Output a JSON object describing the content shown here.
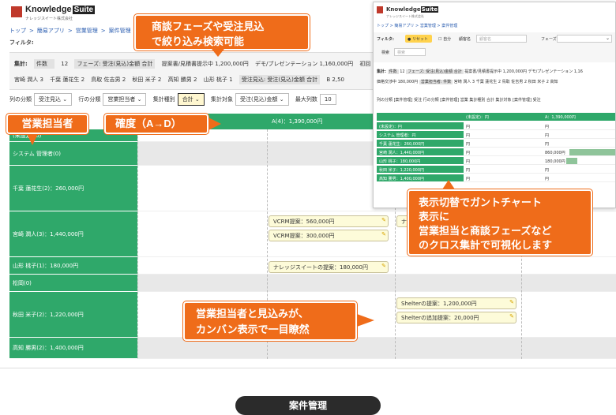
{
  "app": {
    "name": "Knowledge",
    "name_box": "Suite",
    "subtitle": "ナレッジスイート株式会社"
  },
  "breadcrumb": [
    "トップ",
    ">",
    "簡易アプリ",
    ">",
    "営業管理",
    ">",
    "案件管理"
  ],
  "filter_label": "フィルタ:",
  "summary": {
    "label": "集計:",
    "count_label": "件数",
    "count_value": "12",
    "phase_chip": "フェーズ: 受注(見込)金額 合計",
    "line1_items": [
      "提案書/見積書提示中 1,200,000円",
      "デモ/プレゼンテーション 1,160,000円",
      "初回"
    ],
    "line2_items": [
      "宮崎 潤人 3",
      "千葉 蓮花生 2",
      "鳥取 佐吉男 2",
      "秋田 米子 2",
      "高知 勝男 2",
      "山形 桃子 1"
    ],
    "line2_chip": "受注見込: 受注(見込)金額 合計",
    "line2_tail": "B 2,50"
  },
  "controls": {
    "col_label": "列の分類",
    "col_value": "受注見込",
    "row_label": "行の分類",
    "row_value": "営業担当者",
    "agg_label": "集計種別",
    "agg_value": "合計",
    "target_label": "集計対象",
    "target_value": "受注(見込)金額",
    "max_label": "最大列数",
    "max_value": "10"
  },
  "board": {
    "col_a_header": "A(4)：1,390,000円",
    "rows": [
      {
        "name": "(未設定)(0)"
      },
      {
        "name": "システム 管理者(0)"
      },
      {
        "name": "千葉 蓮花生(2)：260,000円"
      },
      {
        "name": "宮崎 潤人(3)：1,440,000円"
      },
      {
        "name": "山形 桃子(1)：180,000円"
      },
      {
        "name": "松岡(0)"
      },
      {
        "name": "秋田 米子(2)：1,220,000円"
      },
      {
        "name": "高知 勝男(2)：1,400,000円"
      }
    ],
    "cards": {
      "vcrm1": "VCRM提案：560,000円",
      "vcrm2": "VCRM提案：300,000円",
      "knowledge_cut": "ナレ",
      "knowledge_suite": "ナレッジスイートの提案：180,000円",
      "shelter1": "Shelterの提案：1,200,000円",
      "shelter2": "Shelterの追加提案：20,000円"
    }
  },
  "callouts": {
    "top": [
      "商談フェーズや受注見込",
      "で絞り込み検索可能"
    ],
    "rep": "営業担当者",
    "grade": "確度（A→D）",
    "gantt": [
      "表示切替でガントチャート",
      "表示に",
      "営業担当と商談フェーズなど",
      "のクロス集計で可視化します"
    ],
    "kanban": [
      "営業担当者と見込みが、",
      "カンバン表示で一目瞭然"
    ]
  },
  "inset": {
    "filter_label": "フィルタ:",
    "reset_btn": "リセット",
    "mine_label": "自分",
    "company_label": "顧客名",
    "company_placeholder": "顧客名",
    "phase_label": "フェーズ",
    "search_label": "検索",
    "search_placeholder": "検索",
    "sum_label": "集計:",
    "count_label": "件数",
    "count_value": "12",
    "sum_chip": "フェーズ: 受注(見込)金額 合計",
    "sum_line1_tail": "提案書/見積書提示中 1,200,000円  デモ/プレゼンテーション 1,16",
    "sum_line2_head": "価格交渉中 180,000円",
    "sum_line2_chip": "営業担当者: 件数",
    "sum_line2_tail": "宮崎 潤人 3  千葉 蓮花生 2  鳥取 佐吉男 2  秋田 米子 2  高知",
    "ctrl_text": "列の分類 [案件管理] 受注   行の分類 [案件管理] 営業   集計種別 合計   集計対象 [案件管理] 受注",
    "col_unset": "(未設定)：円",
    "col_a": "A：1,390,000円",
    "rows": [
      {
        "name": "(未設定)：円",
        "c1": "円",
        "c2": "円"
      },
      {
        "name": "システム 管理者：円",
        "c1": "円",
        "c2": "円"
      },
      {
        "name": "千葉 蓮花生：260,000円",
        "c1": "円",
        "c2": "円"
      },
      {
        "name": "宮崎 潤人：1,440,000円",
        "c1": "円",
        "c2": "860,000円"
      },
      {
        "name": "山形 桃子：180,000円",
        "c1": "円",
        "c2": "180,000円"
      },
      {
        "name": "秋田 米子：1,220,000円",
        "c1": "円",
        "c2": "円"
      },
      {
        "name": "高知 勝男：1,400,000円",
        "c1": "円",
        "c2": "円"
      }
    ]
  },
  "footer": {
    "label": "案件管理"
  },
  "colors": {
    "green": "#2fa86a",
    "orange": "#ef6c1a",
    "card": "#fdfbd9"
  }
}
